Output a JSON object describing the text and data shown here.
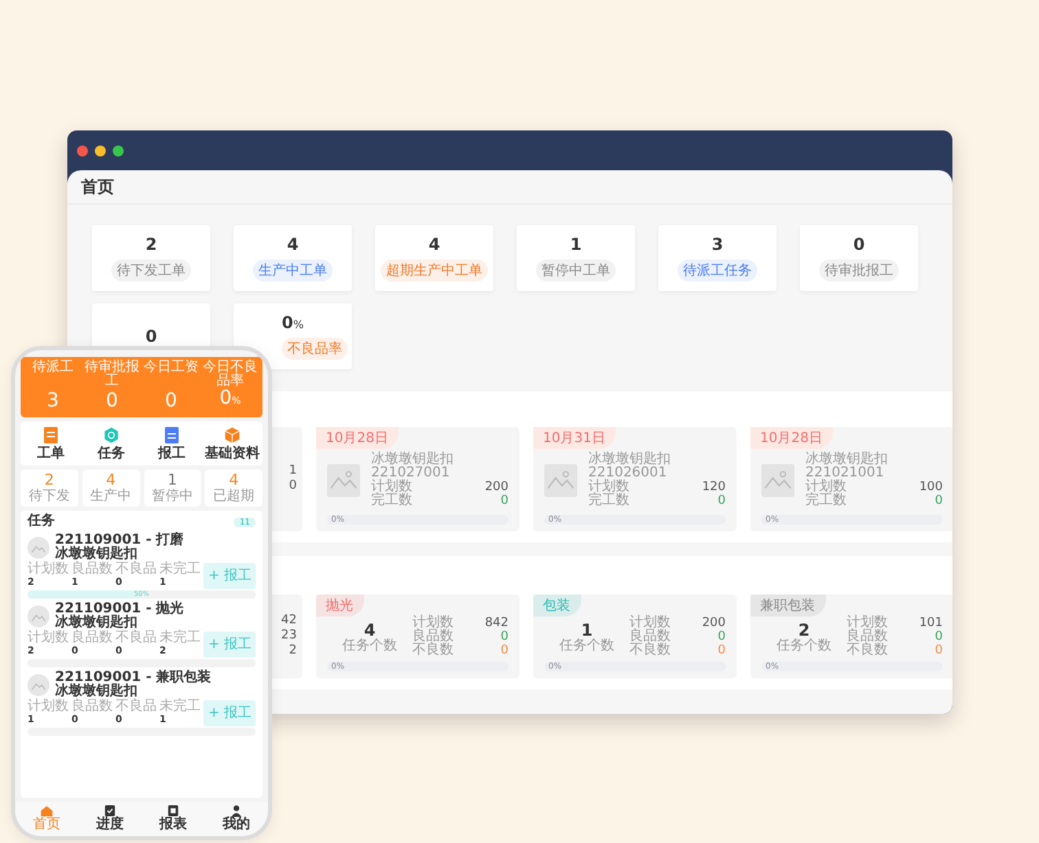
{
  "desktop": {
    "page_title": "首页",
    "stats": [
      {
        "value": "2",
        "label": "待下发工单",
        "color": "#888888"
      },
      {
        "value": "4",
        "label": "生产中工单",
        "color": "#4a7cf0"
      },
      {
        "value": "4",
        "label": "超期生产中工单",
        "color": "#f07a2a"
      },
      {
        "value": "1",
        "label": "暂停中工单",
        "color": "#888888"
      },
      {
        "value": "3",
        "label": "待派工任务",
        "color": "#4a7cf0"
      },
      {
        "value": "0",
        "label": "待审批报工",
        "color": "#888888"
      },
      {
        "value": "0"
      },
      {
        "value": "0",
        "unit": "%",
        "label": "不良品率",
        "color": "#f07a2a"
      }
    ],
    "orders_partial": {
      "values": [
        "1",
        "0"
      ]
    },
    "orders": [
      {
        "date": "10月28日",
        "name": "冰墩墩钥匙扣",
        "code": "221027001",
        "plan_label": "计划数",
        "plan": "200",
        "done_label": "完工数",
        "done": "0",
        "progress": "0%",
        "level": 0
      },
      {
        "date": "10月31日",
        "name": "冰墩墩钥匙扣",
        "code": "221026001",
        "plan_label": "计划数",
        "plan": "120",
        "done_label": "完工数",
        "done": "0",
        "progress": "0%",
        "level": 0
      },
      {
        "date": "10月28日",
        "name": "冰墩墩钥匙扣",
        "code": "221021001",
        "plan_label": "计划数",
        "plan": "100",
        "done_label": "完工数",
        "done": "0",
        "progress": "0%",
        "level": 0
      }
    ],
    "process_partial": {
      "values": [
        "42",
        "23",
        "2"
      ]
    },
    "processes": [
      {
        "tag": "抛光",
        "color": "#f56c6c",
        "count": "4",
        "count_label": "任务个数",
        "plan_label": "计划数",
        "plan": "842",
        "good_label": "良品数",
        "good": "0",
        "bad_label": "不良数",
        "bad": "0",
        "progress": "0%",
        "level": 0
      },
      {
        "tag": "包装",
        "color": "#2bbcb4",
        "count": "1",
        "count_label": "任务个数",
        "plan_label": "计划数",
        "plan": "200",
        "good_label": "良品数",
        "good": "0",
        "bad_label": "不良数",
        "bad": "0",
        "progress": "0%",
        "level": 0
      },
      {
        "tag": "兼职包装",
        "color": "#888888",
        "count": "2",
        "count_label": "任务个数",
        "plan_label": "计划数",
        "plan": "101",
        "good_label": "良品数",
        "good": "0",
        "bad_label": "不良数",
        "bad": "0",
        "progress": "0%",
        "level": 0
      }
    ]
  },
  "phone": {
    "header": [
      {
        "label": "待派工",
        "value": "3"
      },
      {
        "label": "待审批报工",
        "value": "0"
      },
      {
        "label": "今日工资",
        "value": "0"
      },
      {
        "label": "今日不良品率",
        "value": "0",
        "unit": "%"
      }
    ],
    "shortcuts": [
      {
        "kind": "order",
        "label": "工单"
      },
      {
        "kind": "task",
        "label": "任务"
      },
      {
        "kind": "report",
        "label": "报工"
      },
      {
        "kind": "data",
        "label": "基础资料"
      }
    ],
    "counts": [
      {
        "value": "2",
        "label": "待下发"
      },
      {
        "value": "4",
        "label": "生产中"
      },
      {
        "value": "1",
        "label": "暂停中"
      },
      {
        "value": "4",
        "label": "已超期"
      }
    ],
    "tasks_title": "任务",
    "tasks_count": "11",
    "tasks": [
      {
        "title": "221109001 - 打磨",
        "product": "冰墩墩钥匙扣",
        "stats": [
          {
            "label": "计划数",
            "value": "2"
          },
          {
            "label": "良品数",
            "value": "1"
          },
          {
            "label": "不良品",
            "value": "0"
          },
          {
            "label": "未完工",
            "value": "1"
          }
        ],
        "button": "+ 报工",
        "progress": "50%",
        "level": 0.5
      },
      {
        "title": "221109001 - 抛光",
        "product": "冰墩墩钥匙扣",
        "stats": [
          {
            "label": "计划数",
            "value": "2"
          },
          {
            "label": "良品数",
            "value": "0"
          },
          {
            "label": "不良品",
            "value": "0"
          },
          {
            "label": "未完工",
            "value": "2"
          }
        ],
        "button": "+ 报工",
        "level": 0
      },
      {
        "title": "221109001 - 兼职包装",
        "product": "冰墩墩钥匙扣",
        "stats": [
          {
            "label": "计划数",
            "value": "1"
          },
          {
            "label": "良品数",
            "value": "0"
          },
          {
            "label": "不良品",
            "value": "0"
          },
          {
            "label": "未完工",
            "value": "1"
          }
        ],
        "button": "+ 报工",
        "level": 0
      }
    ],
    "nav": [
      {
        "kind": "home",
        "label": "首页",
        "selected": true
      },
      {
        "kind": "progress",
        "label": "进度",
        "selected": false
      },
      {
        "kind": "report",
        "label": "报表",
        "selected": false
      },
      {
        "kind": "user",
        "label": "我的",
        "selected": false
      }
    ]
  }
}
